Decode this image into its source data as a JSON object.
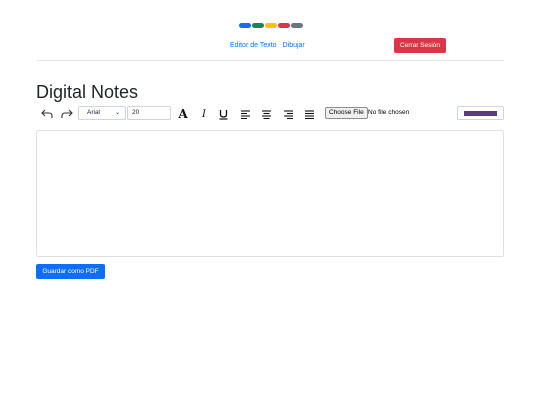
{
  "colors": {
    "pills": [
      "#0d6efd",
      "#198754",
      "#ffc107",
      "#dc3545",
      "#6c757d"
    ],
    "primary": "#0d6efd",
    "danger": "#dc3545",
    "text_color_swatch": "#5a3c7a"
  },
  "nav": {
    "links": [
      "Editor de Texto",
      "Dibujar"
    ],
    "logout_label": "Cerrar Sesión"
  },
  "page": {
    "title": "Digital Notes"
  },
  "toolbar": {
    "undo_icon": "undo-icon",
    "redo_icon": "redo-icon",
    "font_family": "Arial",
    "font_size": "20",
    "bold_icon": "bold-icon",
    "italic_icon": "italic-icon",
    "underline_icon": "underline-icon",
    "align_icons": [
      "align-left-icon",
      "align-center-icon",
      "align-right-icon",
      "align-justify-icon"
    ],
    "file_button_label": "Choose File",
    "file_status": "No file chosen"
  },
  "editor": {
    "content": ""
  },
  "actions": {
    "save_pdf_label": "Guardar como PDF"
  }
}
